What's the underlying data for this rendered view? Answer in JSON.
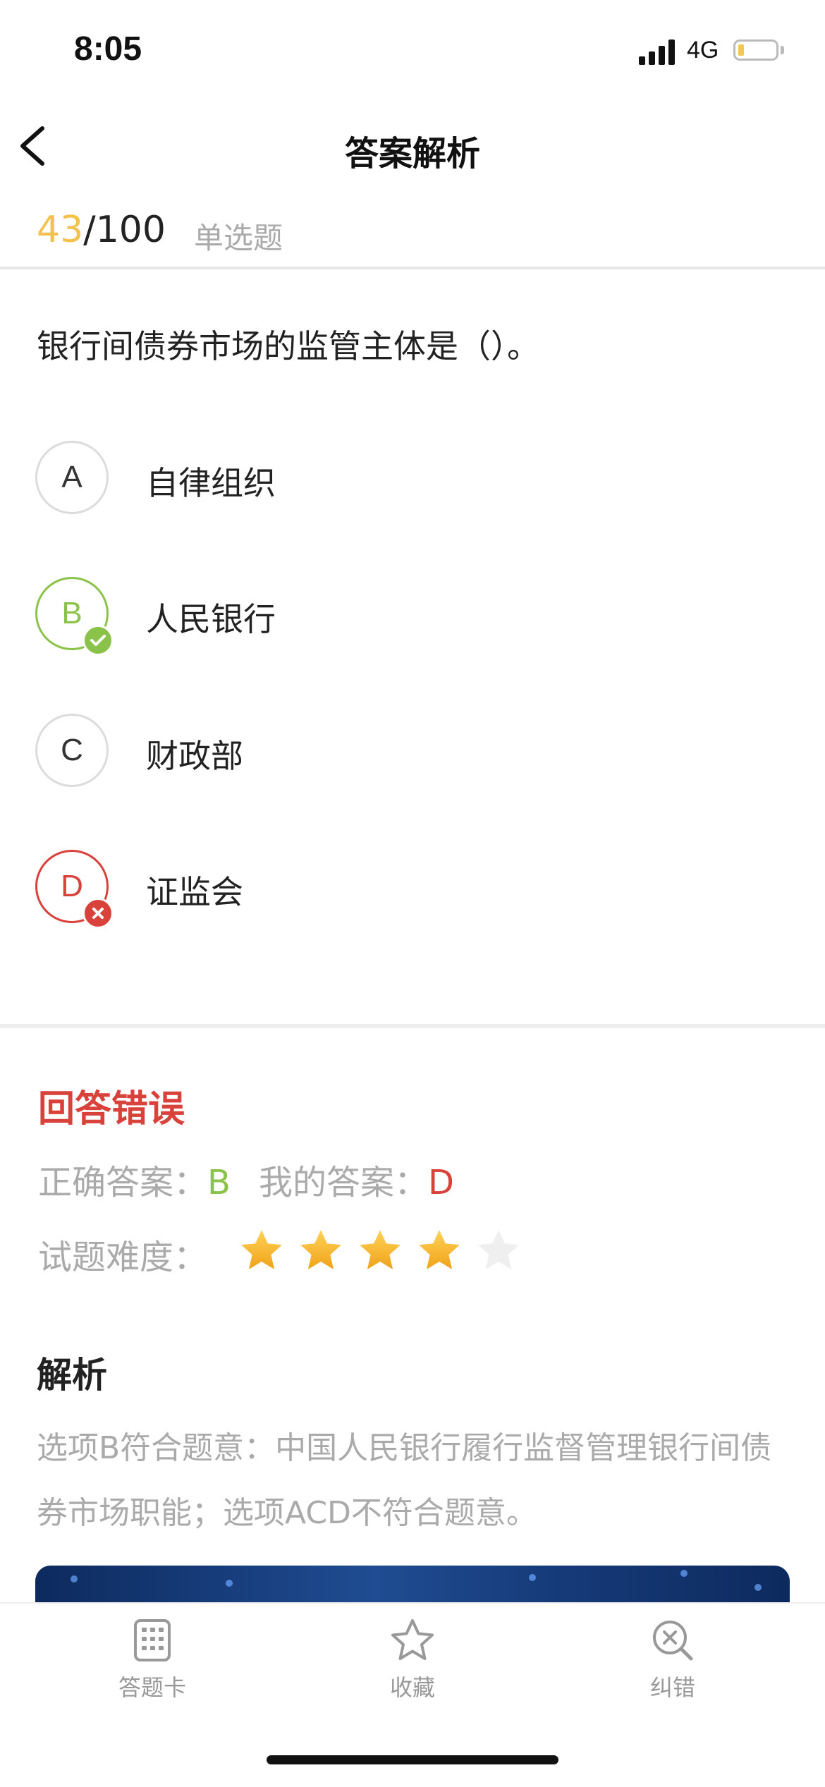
{
  "status_bar": {
    "time": "8:05",
    "network": "4G",
    "battery_color": "#f2c94c"
  },
  "nav": {
    "title": "答案解析",
    "back_icon": "chevron-left-icon"
  },
  "progress": {
    "current": "43",
    "total": "/100",
    "question_type": "单选题"
  },
  "question": {
    "text": "银行间债券市场的监管主体是（）。"
  },
  "options": [
    {
      "letter": "A",
      "text": "自律组织",
      "state": "normal"
    },
    {
      "letter": "B",
      "text": "人民银行",
      "state": "correct"
    },
    {
      "letter": "C",
      "text": "财政部",
      "state": "normal"
    },
    {
      "letter": "D",
      "text": "证监会",
      "state": "wrong"
    }
  ],
  "result": {
    "title": "回答错误",
    "correct_label": "正确答案：",
    "correct_value": "B",
    "mine_label": "我的答案：",
    "mine_value": "D",
    "difficulty_label": "试题难度：",
    "difficulty_stars": 4,
    "difficulty_max": 5
  },
  "analysis": {
    "title": "解析",
    "text": "选项B符合题意：中国人民银行履行监督管理银行间债券市场职能；选项ACD不符合题意。"
  },
  "tabbar": [
    {
      "label": "答题卡",
      "icon": "answer-card-icon"
    },
    {
      "label": "收藏",
      "icon": "star-outline-icon"
    },
    {
      "label": "纠错",
      "icon": "error-search-icon"
    }
  ],
  "colors": {
    "accent_yellow": "#f2c14e",
    "correct_green": "#8bc34a",
    "wrong_red": "#d9413b",
    "banner_blue": "#1f4c92"
  }
}
